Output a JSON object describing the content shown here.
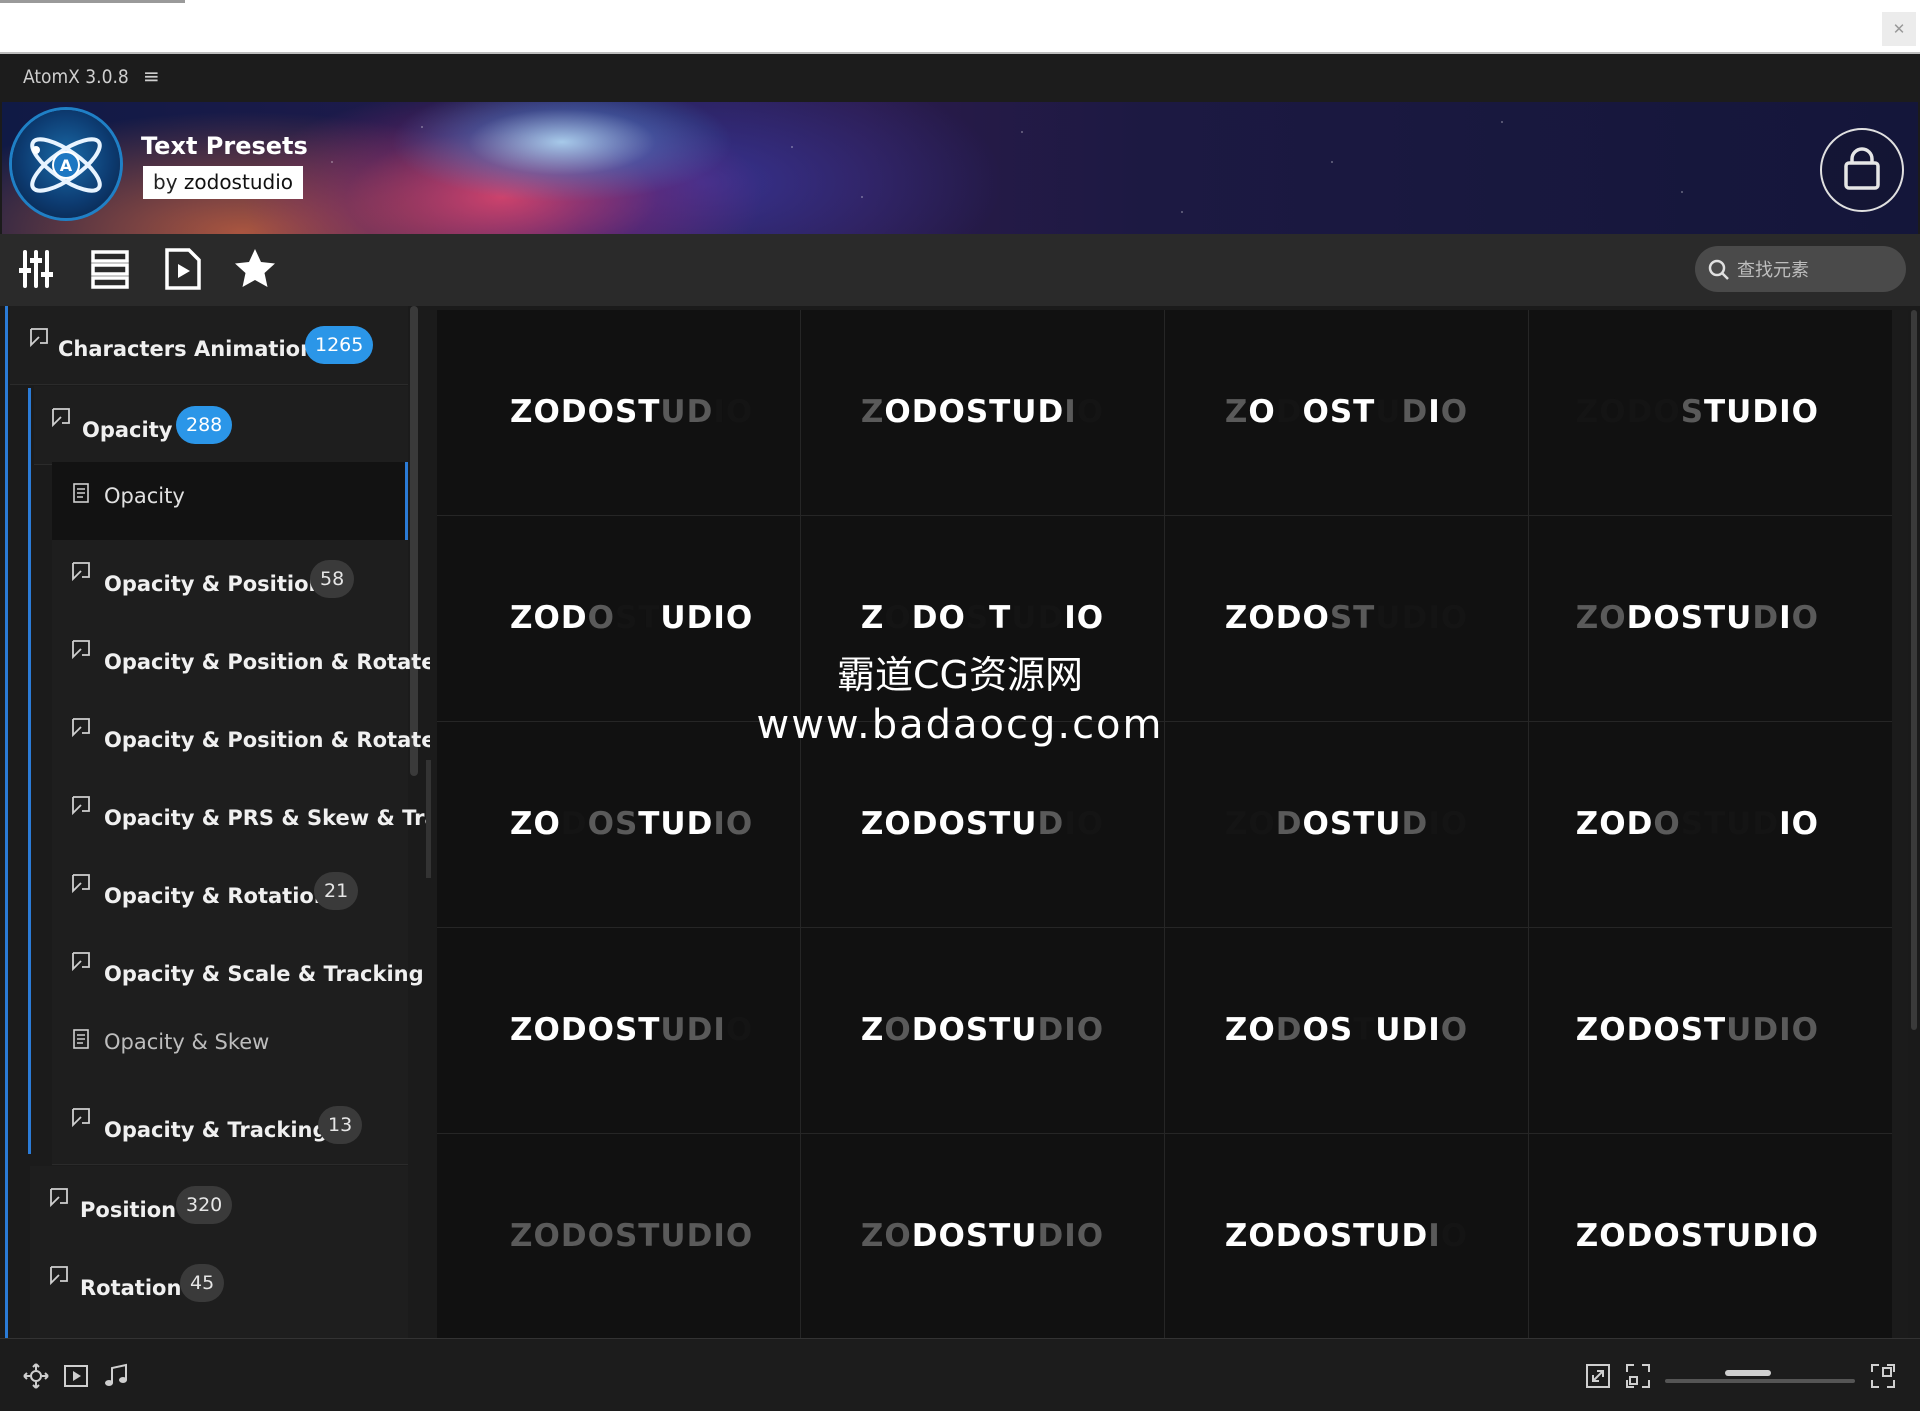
{
  "app": {
    "title": "AtomX 3.0.8",
    "menu_glyph": "≡"
  },
  "banner": {
    "title": "Text Presets",
    "by_prefix": "by",
    "author": "zodostudio"
  },
  "toolbar": {
    "icons": [
      "sliders-icon",
      "list-icon",
      "media-file-icon",
      "star-icon"
    ]
  },
  "search": {
    "placeholder": "查找元素"
  },
  "sidebar": {
    "root": {
      "label": "Characters Animation",
      "count": "1265"
    },
    "group": {
      "label": "Opacity",
      "count": "288"
    },
    "items": [
      {
        "label": "Opacity",
        "count": ""
      },
      {
        "label": "Opacity & Position",
        "count": "58"
      },
      {
        "label": "Opacity & Position & Rotate",
        "count": ""
      },
      {
        "label": "Opacity & Position & Rotate &",
        "count": ""
      },
      {
        "label": "Opacity & PRS & Skew & Trac",
        "count": ""
      },
      {
        "label": "Opacity & Rotation",
        "count": "21"
      },
      {
        "label": "Opacity & Scale & Tracking",
        "count": ""
      },
      {
        "label": "Opacity & Skew",
        "count": ""
      },
      {
        "label": "Opacity & Tracking",
        "count": "13"
      }
    ],
    "siblings": [
      {
        "label": "Position",
        "count": "320"
      },
      {
        "label": "Rotation",
        "count": "45"
      }
    ]
  },
  "grid": {
    "preview_text": "ZODOSTUDIO",
    "colors": {
      "lit": "#ffffff",
      "dim": "#5a5a5a",
      "hidden": "#141414"
    },
    "cells": [
      {
        "align": "left",
        "mask": "LLLLLLDDhh"
      },
      {
        "align": "center",
        "mask": "DLLLLLLLDh"
      },
      {
        "align": "center",
        "mask": "DLhLLLhDLD"
      },
      {
        "align": "right",
        "mask": "hhhhDLLLLL"
      },
      {
        "align": "left",
        "mask": "LLLDhhLLLL"
      },
      {
        "align": "center",
        "mask": "LhLLhLhhLL"
      },
      {
        "align": "center",
        "mask": "LLLLDDhhhh"
      },
      {
        "align": "right",
        "mask": "DDLLLLLDLD"
      },
      {
        "align": "left",
        "mask": "LLhDDLLLDD"
      },
      {
        "align": "center",
        "mask": "LLLLLLLDhh"
      },
      {
        "align": "center",
        "mask": "hhDLLLLDhh"
      },
      {
        "align": "right",
        "mask": "LLLDhhhhLL"
      },
      {
        "align": "left",
        "mask": "LLLLLLDDDh"
      },
      {
        "align": "center",
        "mask": "LDLLLLLDDD"
      },
      {
        "align": "center",
        "mask": "LLDLLhLLLD"
      },
      {
        "align": "right",
        "mask": "LLLLLLDDDD"
      },
      {
        "align": "left",
        "mask": "DDDDDDDDDD"
      },
      {
        "align": "center",
        "mask": "DDLLLLLDDD"
      },
      {
        "align": "center",
        "mask": "LLLLLLLLDh"
      },
      {
        "align": "right",
        "mask": "LLLLLLLLLL"
      }
    ]
  },
  "bottombar": {
    "left_icons": [
      "move-icon",
      "video-icon",
      "music-icon"
    ],
    "right_icons": [
      "resize-icon",
      "fit-icon",
      "expand-icon"
    ]
  },
  "watermark": {
    "line1": "霸道CG资源网",
    "line2": "www.badaocg.com"
  }
}
